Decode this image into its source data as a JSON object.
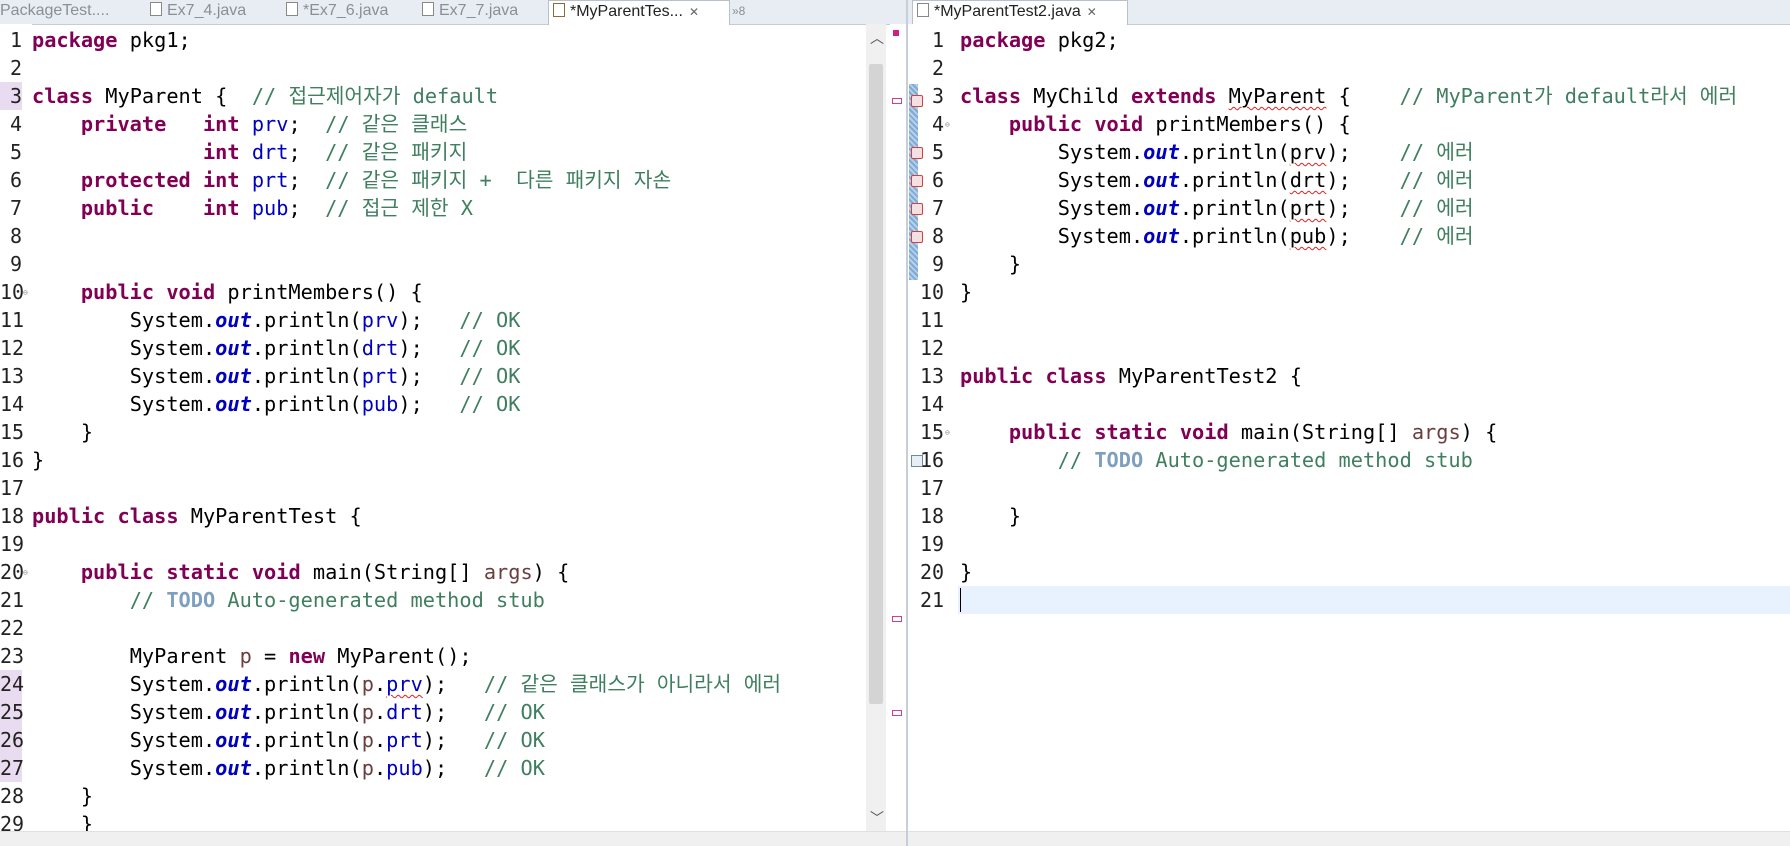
{
  "left_tabs": [
    {
      "label": "PackageTest....",
      "active": false
    },
    {
      "label": "Ex7_4.java",
      "active": false
    },
    {
      "label": "*Ex7_6.java",
      "active": false
    },
    {
      "label": "Ex7_7.java",
      "active": false
    },
    {
      "label": "*MyParentTes...",
      "active": true
    },
    {
      "label": "»8",
      "active": false
    }
  ],
  "right_tabs": [
    {
      "label": "*MyParentTest2.java",
      "active": true
    }
  ],
  "left_editor": {
    "line_numbers": [
      "1",
      "2",
      "3",
      "4",
      "5",
      "6",
      "7",
      "8",
      "9",
      "10",
      "11",
      "12",
      "13",
      "14",
      "15",
      "16",
      "17",
      "18",
      "19",
      "20",
      "21",
      "22",
      "23",
      "24",
      "25",
      "26",
      "27",
      "28",
      "29"
    ],
    "code": {
      "l1": [
        "package",
        " pkg1;"
      ],
      "l3": [
        "class",
        " MyParent {  ",
        "// 접근제어자가 default"
      ],
      "l4": [
        "private",
        "   ",
        "int",
        " ",
        "prv",
        ";  ",
        "// 같은 클래스"
      ],
      "l5": [
        "int",
        " ",
        "drt",
        ";  ",
        "// 같은 패키지"
      ],
      "l6": [
        "protected",
        " ",
        "int",
        " ",
        "prt",
        ";  ",
        "// 같은 패키지 +  다른 패키지 자손"
      ],
      "l7": [
        "public",
        "    ",
        "int",
        " ",
        "pub",
        ";  ",
        "// 접근 제한 X"
      ],
      "l10": [
        "public",
        " ",
        "void",
        " printMembers() {"
      ],
      "l11": [
        "System.",
        "out",
        ".println(",
        "prv",
        ");   ",
        "// OK"
      ],
      "l12": [
        "System.",
        "out",
        ".println(",
        "drt",
        ");   ",
        "// OK"
      ],
      "l13": [
        "System.",
        "out",
        ".println(",
        "prt",
        ");   ",
        "// OK"
      ],
      "l14": [
        "System.",
        "out",
        ".println(",
        "pub",
        ");   ",
        "// OK"
      ],
      "l15": "}",
      "l16": "}",
      "l18": [
        "public",
        " ",
        "class",
        " MyParentTest {"
      ],
      "l20": [
        "public",
        " ",
        "static",
        " ",
        "void",
        " main(String[] ",
        "args",
        ") {"
      ],
      "l21": [
        "// ",
        "TODO",
        " Auto-generated method stub"
      ],
      "l23": [
        "MyParent ",
        "p",
        " = ",
        "new",
        " MyParent();"
      ],
      "l24": [
        "System.",
        "out",
        ".println(",
        "p",
        ".",
        "prv",
        ");   ",
        "// 같은 클래스가 아니라서 에러"
      ],
      "l25": [
        "System.",
        "out",
        ".println(",
        "p",
        ".",
        "drt",
        ");   ",
        "// OK"
      ],
      "l26": [
        "System.",
        "out",
        ".println(",
        "p",
        ".",
        "prt",
        ");   ",
        "// OK"
      ],
      "l27": [
        "System.",
        "out",
        ".println(",
        "p",
        ".",
        "pub",
        ");   ",
        "// OK"
      ],
      "l28": "}",
      "l29": "}"
    }
  },
  "right_editor": {
    "line_numbers": [
      "1",
      "2",
      "3",
      "4",
      "5",
      "6",
      "7",
      "8",
      "9",
      "10",
      "11",
      "12",
      "13",
      "14",
      "15",
      "16",
      "17",
      "18",
      "19",
      "20",
      "21"
    ],
    "code": {
      "l1": [
        "package",
        " pkg2;"
      ],
      "l3": [
        "class",
        " MyChild ",
        "extends",
        " ",
        "MyParent",
        " {    ",
        "// MyParent가 default라서 에러"
      ],
      "l4": [
        "public",
        " ",
        "void",
        " printMembers() {"
      ],
      "l5": [
        "System.",
        "out",
        ".println(",
        "prv",
        ");    ",
        "// 에러"
      ],
      "l6": [
        "System.",
        "out",
        ".println(",
        "drt",
        ");    ",
        "// 에러"
      ],
      "l7": [
        "System.",
        "out",
        ".println(",
        "prt",
        ");    ",
        "// 에러"
      ],
      "l8": [
        "System.",
        "out",
        ".println(",
        "pub",
        ");    ",
        "// 에러"
      ],
      "l9": "}",
      "l10": "}",
      "l13": [
        "public",
        " ",
        "class",
        " MyParentTest2 {"
      ],
      "l15": [
        "public",
        " ",
        "static",
        " ",
        "void",
        " main(String[] ",
        "args",
        ") {"
      ],
      "l16": [
        "// ",
        "TODO",
        " Auto-generated method stub"
      ],
      "l18": "}",
      "l20": "}"
    }
  },
  "colors": {
    "keyword": "#7f0055",
    "comment": "#3f7f5f",
    "field": "#0000c0",
    "todo": "#7f9fbf",
    "current_line": "#e8f2fe"
  }
}
